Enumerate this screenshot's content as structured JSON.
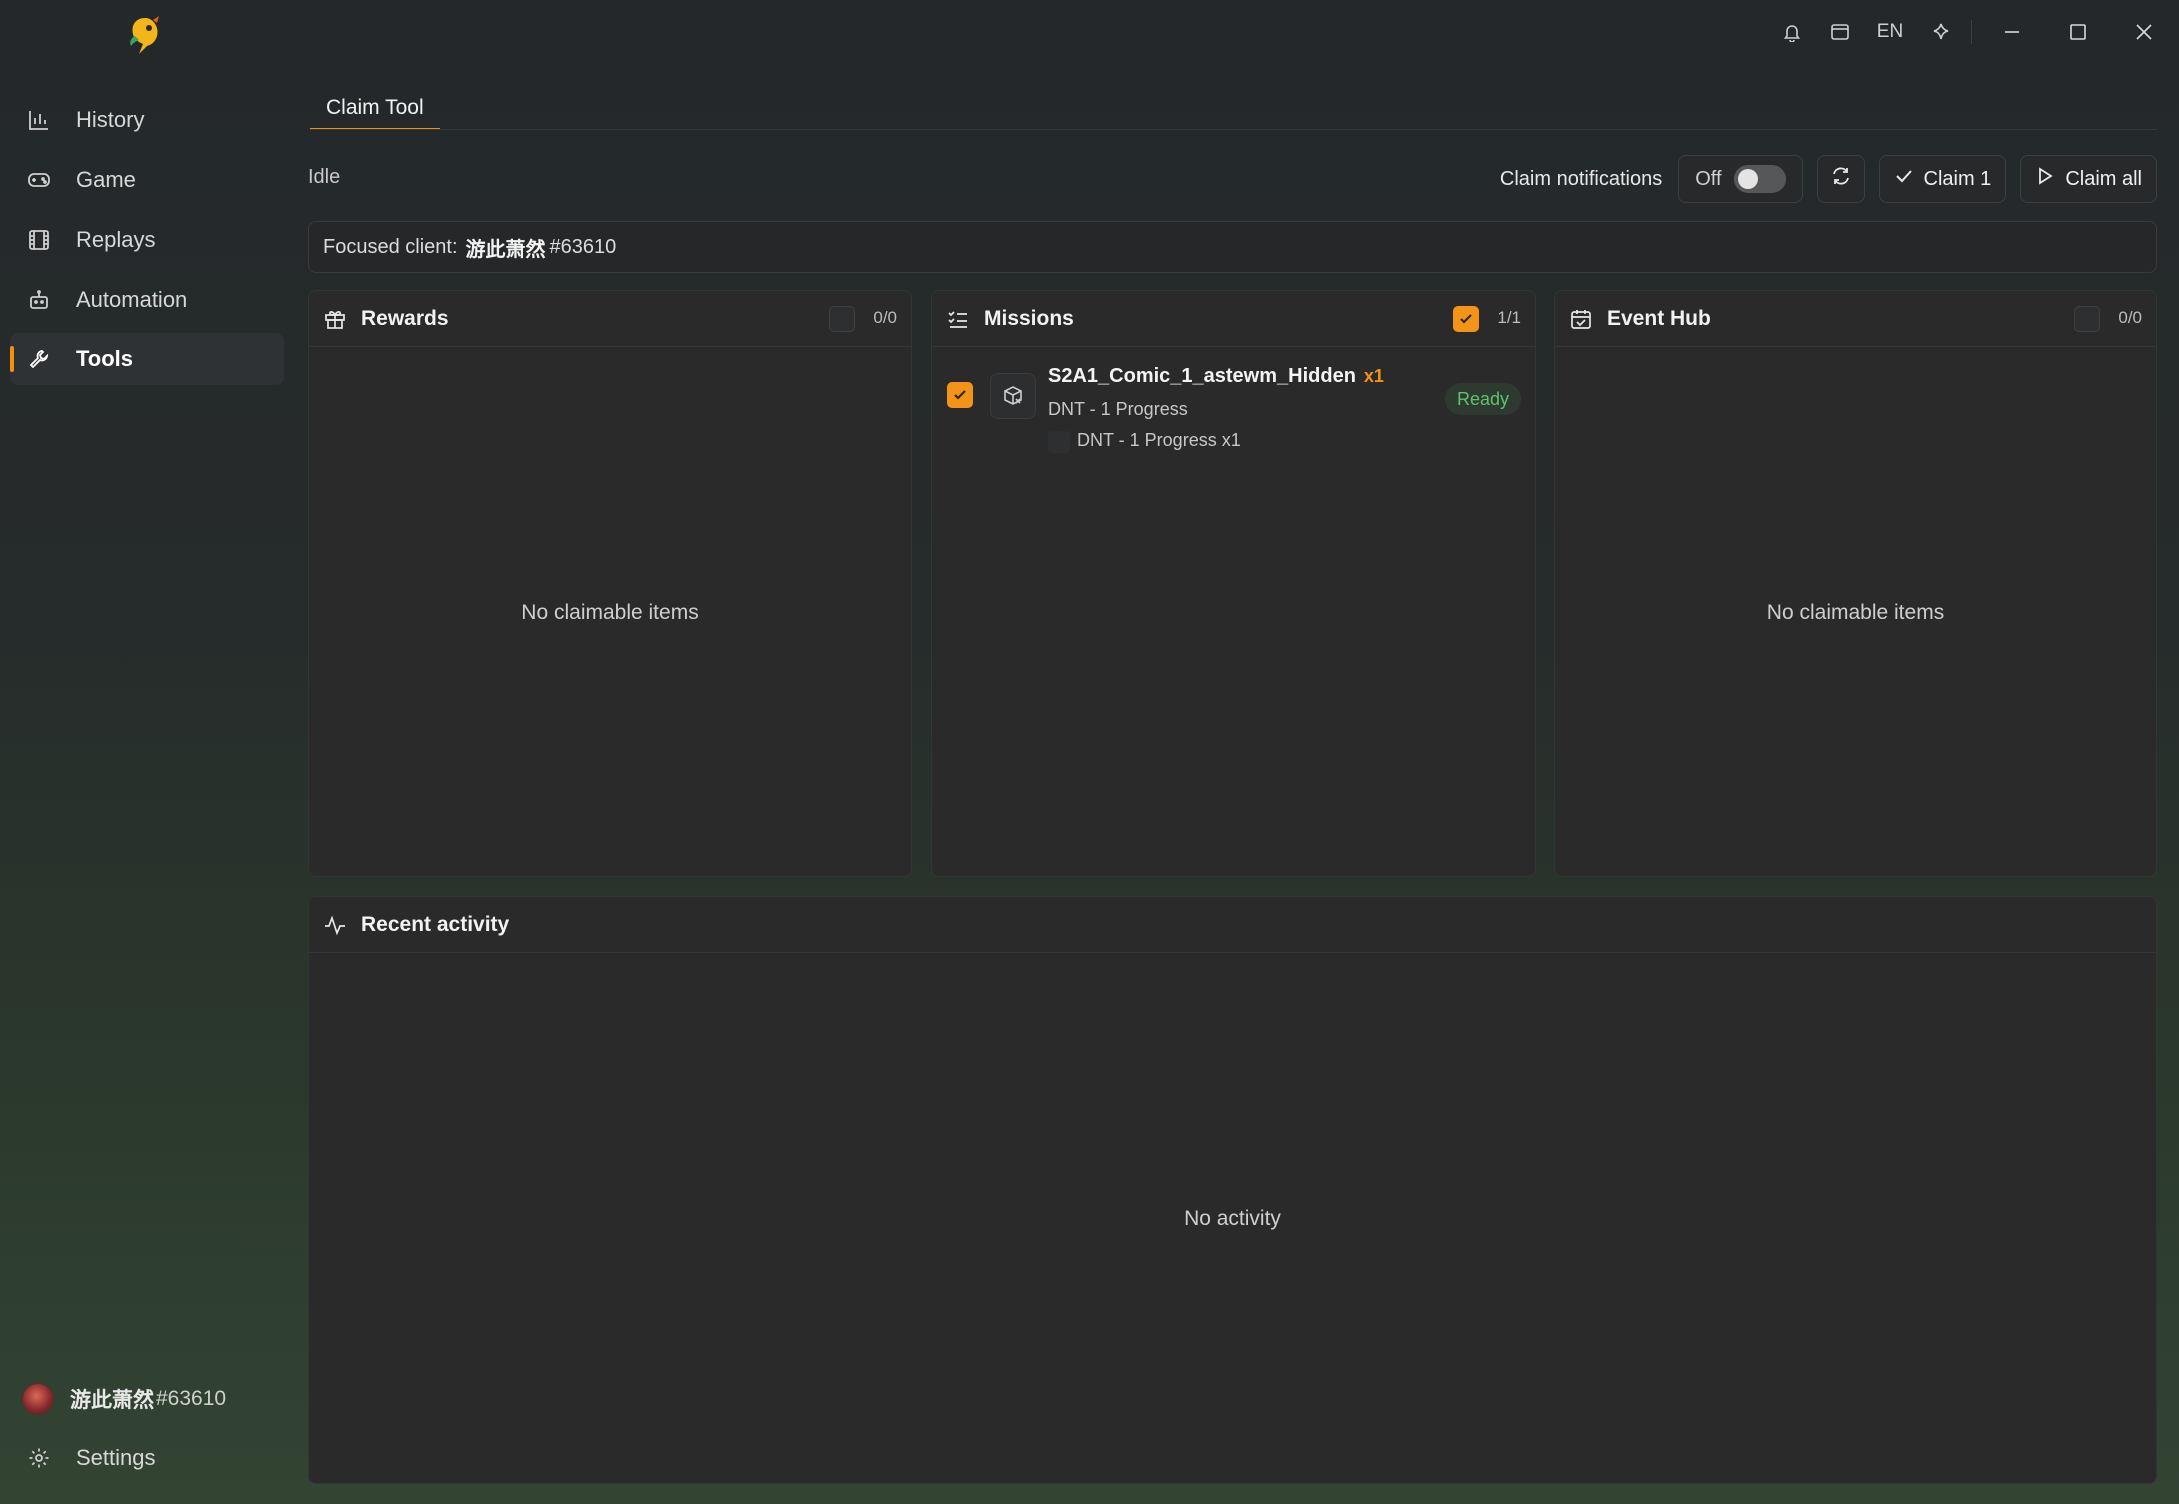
{
  "sidebar": {
    "items": [
      {
        "label": "History",
        "icon": "bar-chart-icon"
      },
      {
        "label": "Game",
        "icon": "gamepad-icon"
      },
      {
        "label": "Replays",
        "icon": "film-icon"
      },
      {
        "label": "Automation",
        "icon": "robot-icon"
      },
      {
        "label": "Tools",
        "icon": "wrench-icon",
        "active": true
      }
    ],
    "user": {
      "name": "游此萧然",
      "tag": "#63610"
    },
    "settings_label": "Settings"
  },
  "titlebar": {
    "language": "EN",
    "icons": [
      "bell-icon",
      "window-icon",
      "sparkle-icon",
      "minimize-icon",
      "maximize-icon",
      "close-icon"
    ]
  },
  "main": {
    "tab_label": "Claim Tool",
    "status": "Idle",
    "toolbar": {
      "notifications_label": "Claim notifications",
      "toggle_state": "Off",
      "claim_one_label": "Claim 1",
      "claim_all_label": "Claim all"
    },
    "focused": {
      "label": "Focused client:",
      "name": "游此萧然",
      "tag": "#63610"
    },
    "panels": {
      "rewards": {
        "title": "Rewards",
        "count": "0/0",
        "empty": "No claimable items"
      },
      "missions": {
        "title": "Missions",
        "count": "1/1",
        "items": [
          {
            "name": "S2A1_Comic_1_astewm_Hidden",
            "qty": "x1",
            "subtitle": "DNT - 1 Progress",
            "detail": "DNT - 1 Progress x1",
            "status": "Ready"
          }
        ]
      },
      "event_hub": {
        "title": "Event Hub",
        "count": "0/0",
        "empty": "No claimable items"
      },
      "activity": {
        "title": "Recent activity",
        "empty": "No activity"
      }
    }
  },
  "colors": {
    "accent": "#f39419",
    "ready": "#5ec46a"
  }
}
